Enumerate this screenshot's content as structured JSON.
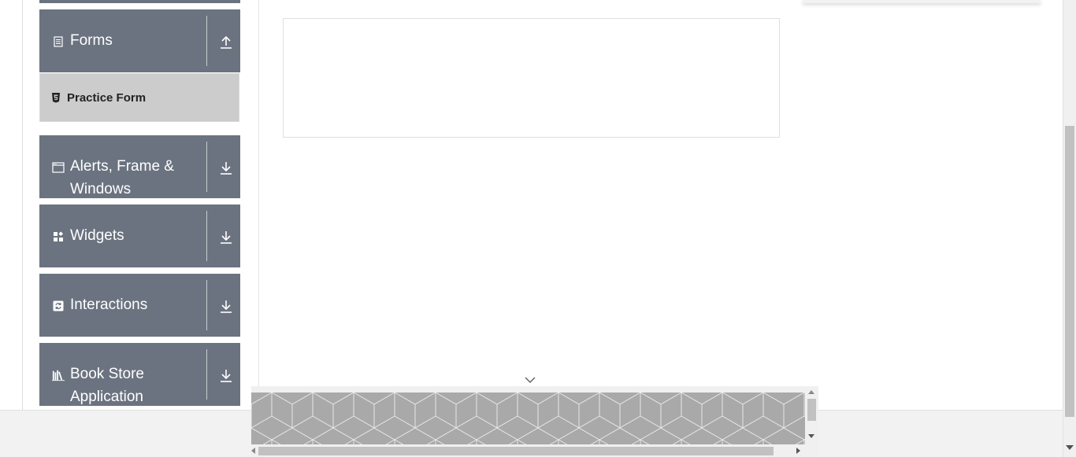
{
  "sidebar": {
    "groups": [
      {
        "label": "Forms",
        "icon": "document-icon",
        "state": "expanded"
      },
      {
        "label": "Alerts, Frame & Windows",
        "icon": "window-icon",
        "state": "collapsed"
      },
      {
        "label": "Widgets",
        "icon": "widgets-icon",
        "state": "collapsed"
      },
      {
        "label": "Interactions",
        "icon": "interactions-icon",
        "state": "collapsed"
      },
      {
        "label": "Book Store Application",
        "icon": "bookstore-icon",
        "state": "collapsed"
      }
    ],
    "forms_items": [
      {
        "label": "Practice Form",
        "icon": "html5-icon"
      }
    ]
  },
  "colors": {
    "group_bg": "#6b7380",
    "selected_item_bg": "#cccccc",
    "ad_bg": "#a9a9a9"
  }
}
